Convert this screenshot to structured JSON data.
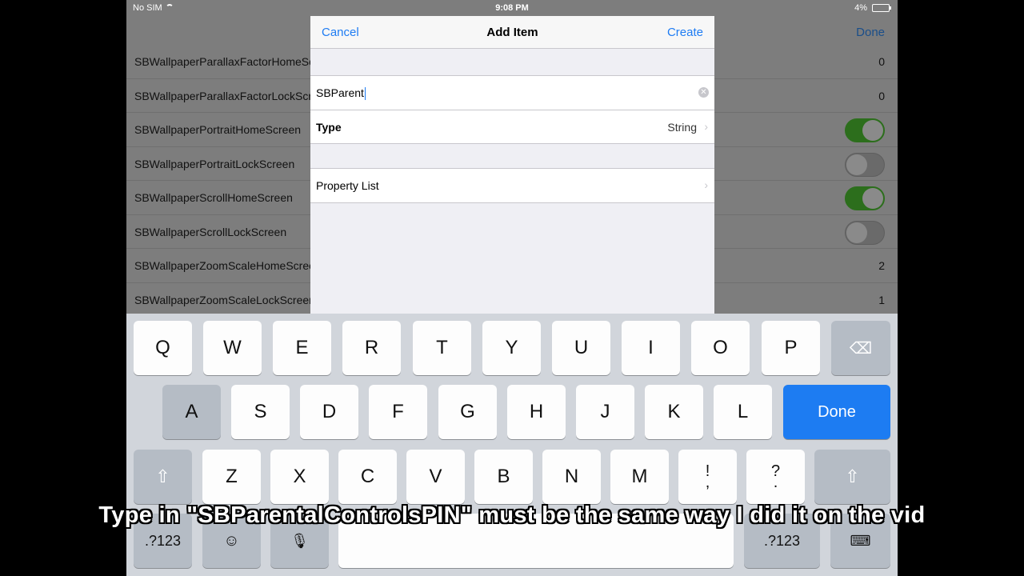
{
  "status_bar": {
    "carrier": "No SIM",
    "time": "9:08 PM",
    "battery": "4%"
  },
  "background": {
    "done_label": "Done",
    "rows": [
      {
        "key": "SBWallpaperParallaxFactorHomeScreen",
        "value": "0"
      },
      {
        "key": "SBWallpaperParallaxFactorLockScreen",
        "value": "0"
      },
      {
        "key": "SBWallpaperPortraitHomeScreen",
        "toggle": "on"
      },
      {
        "key": "SBWallpaperPortraitLockScreen",
        "toggle": "off"
      },
      {
        "key": "SBWallpaperScrollHomeScreen",
        "toggle": "on"
      },
      {
        "key": "SBWallpaperScrollLockScreen",
        "toggle": "off"
      },
      {
        "key": "SBWallpaperZoomScaleHomeScreen",
        "value": "2"
      },
      {
        "key": "SBWallpaperZoomScaleLockScreen",
        "value": "1"
      }
    ]
  },
  "modal": {
    "title": "Add Item",
    "cancel_label": "Cancel",
    "create_label": "Create",
    "name_value": "SBParent",
    "type_label": "Type",
    "type_value": "String",
    "property_list_label": "Property List"
  },
  "keyboard": {
    "row1": [
      "Q",
      "W",
      "E",
      "R",
      "T",
      "Y",
      "U",
      "I",
      "O",
      "P"
    ],
    "row2": [
      "A",
      "S",
      "D",
      "F",
      "G",
      "H",
      "J",
      "K",
      "L"
    ],
    "row3": [
      "Z",
      "X",
      "C",
      "V",
      "B",
      "N",
      "M"
    ],
    "done_label": "Done",
    "numbers_label": ".?123",
    "exclaim_top": "!",
    "exclaim_bottom": ",",
    "question_top": "?",
    "question_bottom": ".",
    "icons": [
      "backspace-icon",
      "shift-icon",
      "emoji-icon",
      "microphone-icon",
      "hide-keyboard-icon"
    ]
  },
  "caption": "Type in \"SBParentalControlsPIN\" must be the same way I did it on the vid"
}
